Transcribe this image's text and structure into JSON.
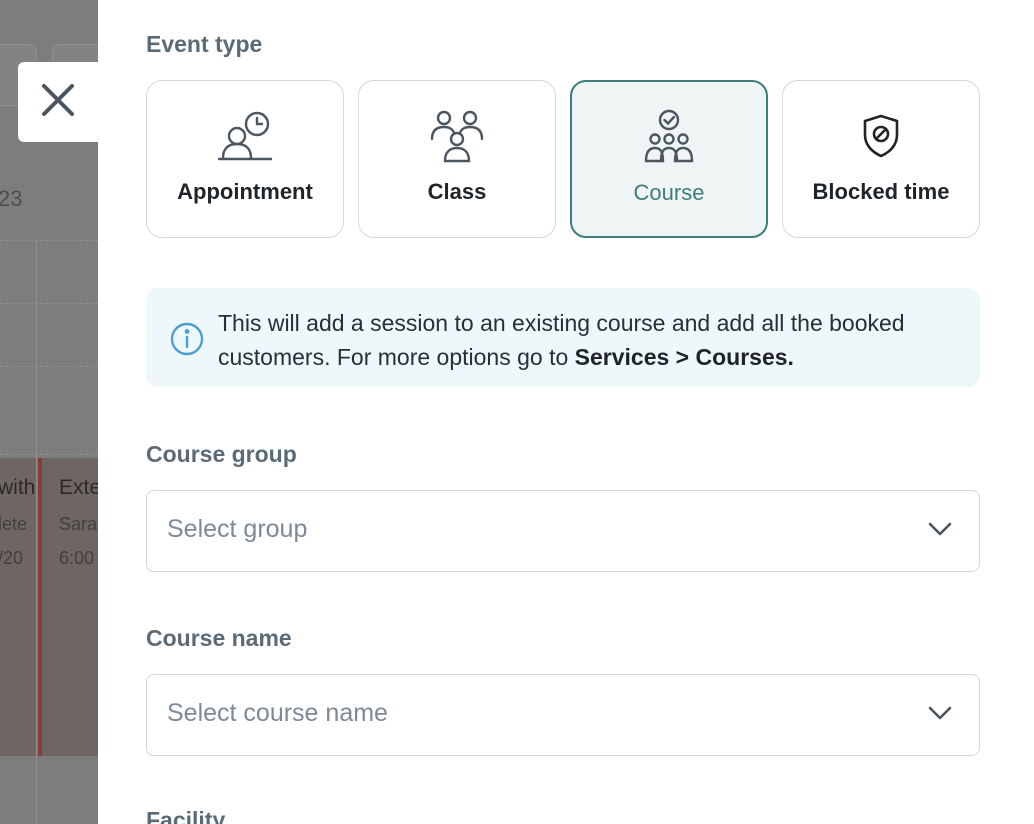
{
  "background": {
    "date_fragment": "23",
    "events": [
      {
        "title": "with",
        "subtitle": "lete",
        "time": "/20"
      },
      {
        "title": "Exte",
        "subtitle": "Sara",
        "time": "6:00"
      }
    ]
  },
  "close_icon": "close-icon",
  "event_type": {
    "label": "Event type",
    "options": [
      {
        "label": "Appointment",
        "icon": "person-clock-icon",
        "selected": false
      },
      {
        "label": "Class",
        "icon": "people-group-icon",
        "selected": false
      },
      {
        "label": "Course",
        "icon": "group-check-icon",
        "selected": true
      },
      {
        "label": "Blocked time",
        "icon": "shield-blocked-icon",
        "selected": false
      }
    ]
  },
  "info": {
    "icon": "info-icon",
    "text_before": "This will add a session to an existing course and add all the booked customers. For more options go to ",
    "text_bold": "Services > Courses."
  },
  "course_group": {
    "label": "Course group",
    "placeholder": "Select group"
  },
  "course_name": {
    "label": "Course name",
    "placeholder": "Select course name"
  },
  "facility": {
    "label": "Facility"
  },
  "colors": {
    "accent": "#3d7d7a",
    "selected_bg": "#eff4f4",
    "info_bg": "#eef7fa",
    "info_icon": "#4a9fd0",
    "label": "#5a6b77"
  }
}
